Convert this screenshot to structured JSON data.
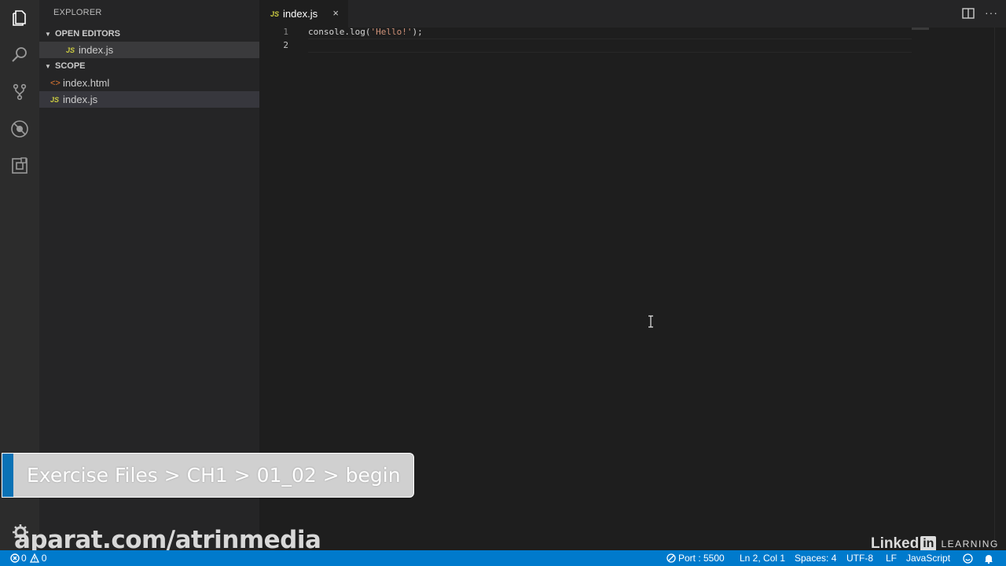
{
  "sidebar": {
    "title": "EXPLORER",
    "open_editors_label": "OPEN EDITORS",
    "open_editors": [
      {
        "badge": "JS",
        "name": "index.js"
      }
    ],
    "folder_label": "SCOPE",
    "files": [
      {
        "badge": "<>",
        "name": "index.html"
      },
      {
        "badge": "JS",
        "name": "index.js"
      }
    ]
  },
  "tabs": [
    {
      "badge": "JS",
      "label": "index.js",
      "close": "×"
    }
  ],
  "editor": {
    "lines": [
      {
        "number": "1",
        "code_plain_1": "console.log(",
        "code_str": "'Hello!'",
        "code_plain_2": ");"
      },
      {
        "number": "2"
      }
    ]
  },
  "overlay": {
    "text": "Exercise Files > CH1 > 01_02 > begin"
  },
  "watermark": {
    "text": "aparat.com/atrinmedia"
  },
  "linkedin": {
    "brand_1": "Linked",
    "brand_box": "in",
    "brand_2": "LEARNING"
  },
  "status_bar": {
    "errors": "0",
    "warnings": "0",
    "port": "Port : 5500",
    "position": "Ln 2, Col 1",
    "spaces": "Spaces: 4",
    "encoding": "UTF-8",
    "eol": "LF",
    "language": "JavaScript"
  },
  "colors": {
    "accent": "#007acc",
    "background": "#1e1e1e",
    "sidebar": "#252526",
    "activity_bar": "#2c2c2c"
  }
}
